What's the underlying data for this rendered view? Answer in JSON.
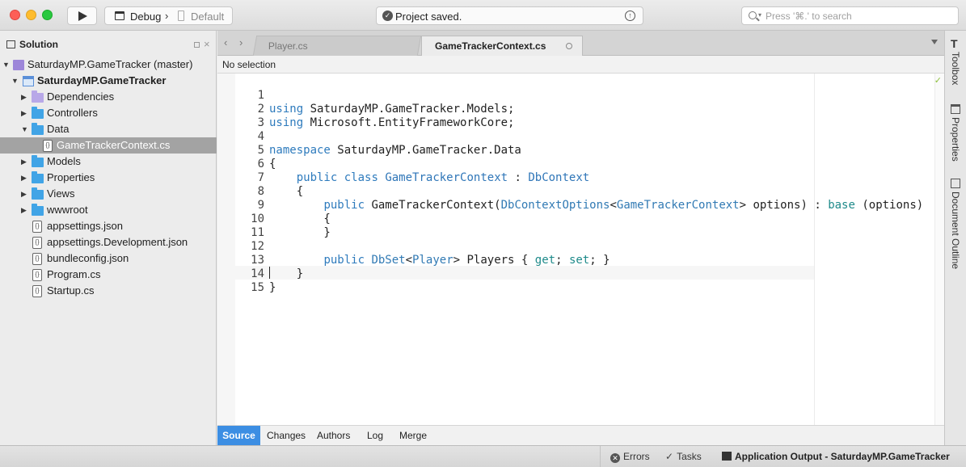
{
  "toolbar": {
    "configuration": "Debug",
    "device": "Default",
    "status": "Project saved.",
    "search_placeholder": "Press '⌘.' to search"
  },
  "solution": {
    "title": "Solution",
    "tree": [
      {
        "label": "SaturdayMP.GameTracker (master)",
        "icon": "solution-icon",
        "expanded": true
      },
      {
        "label": "SaturdayMP.GameTracker",
        "icon": "project-icon",
        "expanded": true,
        "bold": true
      },
      {
        "label": "Dependencies",
        "icon": "dependencies-folder-icon",
        "expanded": false
      },
      {
        "label": "Controllers",
        "icon": "folder-icon",
        "expanded": false
      },
      {
        "label": "Data",
        "icon": "folder-icon",
        "expanded": true
      },
      {
        "label": "GameTrackerContext.cs",
        "icon": "csharp-file-icon",
        "selected": true
      },
      {
        "label": "Models",
        "icon": "folder-icon",
        "expanded": false
      },
      {
        "label": "Properties",
        "icon": "folder-icon",
        "expanded": false
      },
      {
        "label": "Views",
        "icon": "folder-icon",
        "expanded": false
      },
      {
        "label": "wwwroot",
        "icon": "folder-icon",
        "expanded": false
      },
      {
        "label": "appsettings.json",
        "icon": "json-file-icon"
      },
      {
        "label": "appsettings.Development.json",
        "icon": "json-file-icon"
      },
      {
        "label": "bundleconfig.json",
        "icon": "json-file-icon"
      },
      {
        "label": "Program.cs",
        "icon": "csharp-file-icon"
      },
      {
        "label": "Startup.cs",
        "icon": "csharp-file-icon"
      }
    ]
  },
  "tabs": [
    {
      "label": "Player.cs",
      "active": false
    },
    {
      "label": "GameTrackerContext.cs",
      "active": true
    }
  ],
  "breadcrumb": "No selection",
  "editor": {
    "lines": [
      {
        "n": "1",
        "text": "using SaturdayMP.GameTracker.Models;"
      },
      {
        "n": "2",
        "text": "using Microsoft.EntityFrameworkCore;"
      },
      {
        "n": "3",
        "text": ""
      },
      {
        "n": "4",
        "text": "namespace SaturdayMP.GameTracker.Data"
      },
      {
        "n": "5",
        "text": "{"
      },
      {
        "n": "6",
        "text": "    public class GameTrackerContext : DbContext"
      },
      {
        "n": "7",
        "text": "    {"
      },
      {
        "n": "8",
        "text": "        public GameTrackerContext(DbContextOptions<GameTrackerContext> options) : base (options)"
      },
      {
        "n": "9",
        "text": "        {"
      },
      {
        "n": "10",
        "text": "        }"
      },
      {
        "n": "11",
        "text": ""
      },
      {
        "n": "12",
        "text": "        public DbSet<Player> Players { get; set; }"
      },
      {
        "n": "13",
        "text": "    }"
      },
      {
        "n": "14",
        "text": "}"
      },
      {
        "n": "15",
        "text": ""
      }
    ]
  },
  "vcs_tabs": [
    "Source",
    "Changes",
    "Authors",
    "Log",
    "Merge"
  ],
  "side_pads": [
    "Toolbox",
    "Properties",
    "Document Outline"
  ],
  "statusbar": {
    "errors": "Errors",
    "tasks": "Tasks",
    "output": "Application Output - SaturdayMP.GameTracker"
  },
  "colors": {
    "accent": "#3c8ee3",
    "keyword": "#2e7bbd",
    "folder": "#41a4e6",
    "selection": "#a3a3a3"
  }
}
